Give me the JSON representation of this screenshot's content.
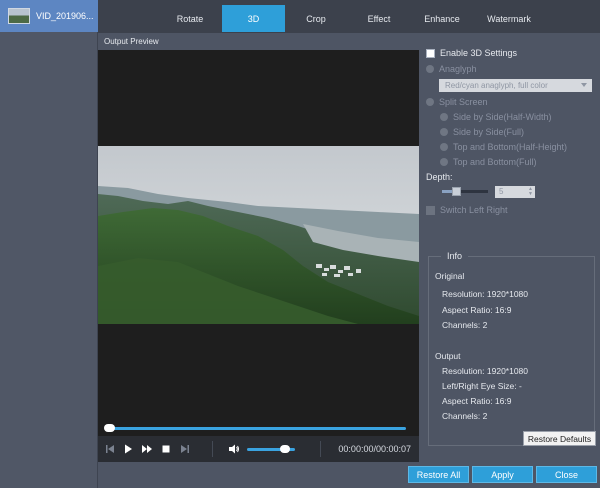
{
  "file": {
    "name": "VID_201906..."
  },
  "tabs": [
    {
      "label": "Rotate"
    },
    {
      "label": "3D"
    },
    {
      "label": "Crop"
    },
    {
      "label": "Effect"
    },
    {
      "label": "Enhance"
    },
    {
      "label": "Watermark"
    }
  ],
  "active_tab": "3D",
  "preview": {
    "title": "Output Preview",
    "progress": 0.0
  },
  "player": {
    "time": "00:00:00/00:00:07",
    "volume": 0.8
  },
  "settings": {
    "enable_3d_label": "Enable 3D Settings",
    "enable_3d_checked": false,
    "anaglyph_label": "Anaglyph",
    "anaglyph_select": "Red/cyan anaglyph, full color",
    "split_screen_label": "Split Screen",
    "split_options": [
      {
        "label": "Side by Side(Half-Width)"
      },
      {
        "label": "Side by Side(Full)"
      },
      {
        "label": "Top and Bottom(Half-Height)"
      },
      {
        "label": "Top and Bottom(Full)"
      }
    ],
    "depth_label": "Depth:",
    "depth_value": "5",
    "depth_level": 0.3,
    "switch_lr_label": "Switch Left Right"
  },
  "info": {
    "legend": "Info",
    "original_heading": "Original",
    "original": {
      "resolution": "Resolution: 1920*1080",
      "aspect": "Aspect Ratio: 16:9",
      "channels": "Channels: 2"
    },
    "output_heading": "Output",
    "output": {
      "resolution": "Resolution: 1920*1080",
      "eye_size": "Left/Right Eye Size: -",
      "aspect": "Aspect Ratio: 16:9",
      "channels": "Channels: 2"
    }
  },
  "buttons": {
    "restore_defaults": "Restore Defaults",
    "restore_all": "Restore All",
    "apply": "Apply",
    "close": "Close"
  },
  "colors": {
    "accent": "#2e9fd9",
    "panel": "#4e5564",
    "tabbar": "#3c414c"
  }
}
